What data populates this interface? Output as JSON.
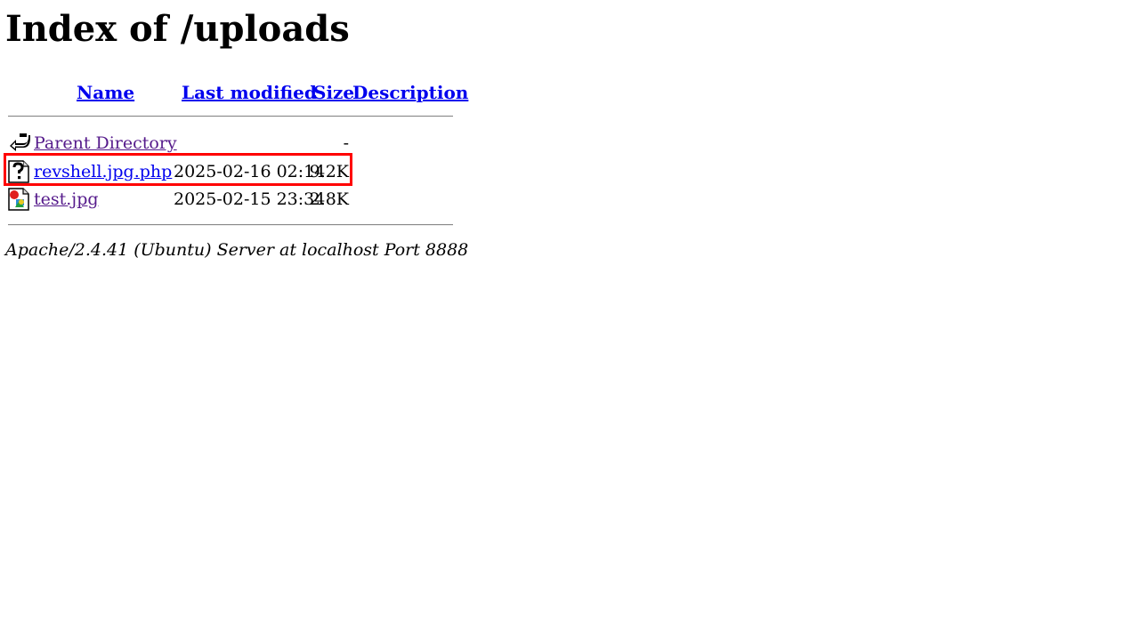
{
  "title": "Index of /uploads",
  "columns": {
    "name": "Name",
    "last_modified": "Last modified",
    "size": "Size",
    "description": "Description"
  },
  "rows": [
    {
      "name": "Parent Directory",
      "modified": "",
      "size": "-",
      "icon": "back-icon"
    },
    {
      "name": "revshell.jpg.php",
      "modified": "2025-02-16 02:14",
      "size": "9.2K",
      "icon": "unknown-file-icon"
    },
    {
      "name": "test.jpg",
      "modified": "2025-02-15 23:34",
      "size": "2.8K",
      "icon": "image-file-icon"
    }
  ],
  "footer": "Apache/2.4.41 (Ubuntu) Server at localhost Port 8888",
  "colors": {
    "link": "#0000ee",
    "visited": "#551a8b",
    "highlight": "#ff0000"
  }
}
